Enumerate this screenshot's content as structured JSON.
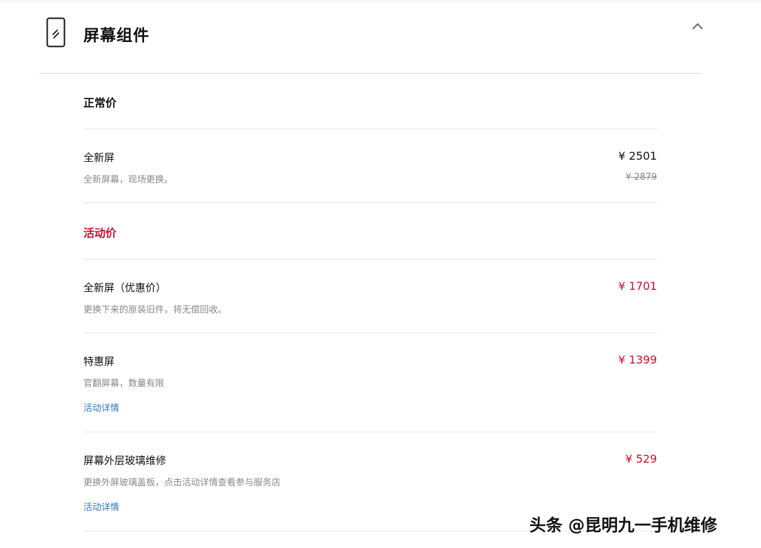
{
  "section": {
    "title": "屏幕组件"
  },
  "groups": {
    "normal": {
      "heading": "正常价"
    },
    "promo": {
      "heading": "活动价"
    }
  },
  "items": [
    {
      "name": "全新屏",
      "desc": "全新屏幕，现场更换。",
      "price": "¥ 2501",
      "old_price": "¥ 2879"
    },
    {
      "name": "全新屏（优惠价）",
      "desc": "更换下来的原装旧件，将无偿回收。",
      "price": "¥ 1701"
    },
    {
      "name": "特惠屏",
      "desc": "官翻屏幕，数量有限",
      "price": "¥ 1399",
      "link": "活动详情"
    },
    {
      "name": "屏幕外层玻璃维修",
      "desc": "更换外屏玻璃盖板，点击活动详情查看参与服务店",
      "price": "¥ 529",
      "link": "活动详情"
    }
  ],
  "watermark": "头条 @昆明九一手机维修",
  "colors": {
    "promo_red": "#c8102e",
    "link_blue": "#2a7ab8",
    "muted": "#888888"
  },
  "icons": {
    "section": "phone-icon",
    "collapse": "chevron-up-icon"
  }
}
